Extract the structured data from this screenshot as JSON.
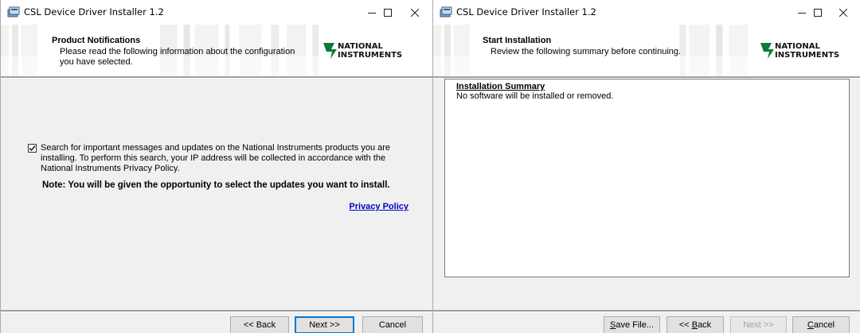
{
  "left_window": {
    "title": "CSL Device Driver Installer 1.2",
    "header": {
      "title": "Product Notifications",
      "description": "Please read the following information about the configuration you have selected.",
      "logo_line1": "NATIONAL",
      "logo_line2": "INSTRUMENTS"
    },
    "checkbox_checked": true,
    "checkbox_label": "Search for important messages and updates on the National Instruments products you are installing. To perform this search, your IP address will be collected in accordance with the National Instruments Privacy Policy.",
    "note": "Note: You will be given the opportunity to select the updates you want to install.",
    "privacy_link": "Privacy Policy",
    "buttons": {
      "back": "<< Back",
      "next": "Next >>",
      "cancel": "Cancel"
    }
  },
  "right_window": {
    "title": "CSL Device Driver Installer 1.2",
    "header": {
      "title": "Start Installation",
      "description": "Review the following summary before continuing.",
      "logo_line1": "NATIONAL",
      "logo_line2": "INSTRUMENTS"
    },
    "summary_title": "Installation Summary",
    "summary_text": "No software will be installed or removed.",
    "buttons": {
      "save_file_key": "S",
      "save_file_rest": "ave File...",
      "back_pre": "<< ",
      "back_key": "B",
      "back_rest": "ack",
      "next": "Next >>",
      "cancel_key": "C",
      "cancel_rest": "ancel"
    }
  },
  "colors": {
    "default_button_border": "#0078d7",
    "link": "#0000cc",
    "ni_logo_green": "#0a7a3a"
  },
  "icons": [
    "installer-app-icon",
    "minimize-icon",
    "maximize-icon",
    "close-icon",
    "ni-eagle-icon",
    "checkmark-icon"
  ]
}
